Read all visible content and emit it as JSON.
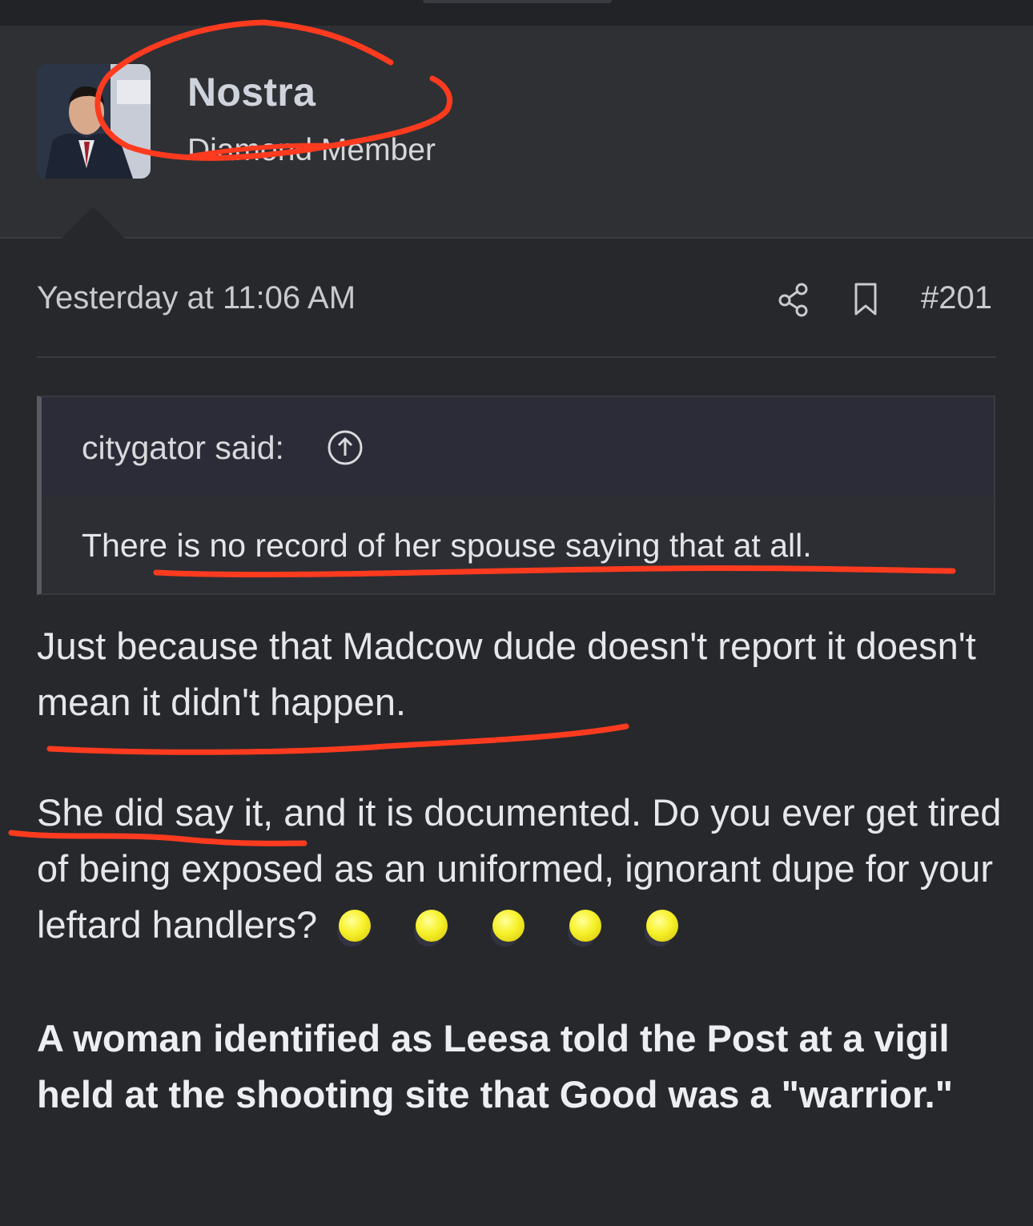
{
  "post": {
    "author": "Nostra",
    "author_title": "Diamond Member",
    "timestamp": "Yesterday at 11:06 AM",
    "post_number": "#201",
    "icons": [
      "share-icon",
      "bookmark-icon"
    ]
  },
  "quote": {
    "author_label": "citygator said:",
    "jump_icon": "arrow-up-circle-icon",
    "text": "There is no record of her spouse saying that at all."
  },
  "message": {
    "paragraph_1": "Just because that Madcow dude doesn't report it doesn't mean it didn't happen.",
    "paragraph_2": "She did say it, and it is documented. Do you ever get tired of being exposed as an uniformed, ignorant dupe for your leftard handlers?",
    "emoji_count": 5,
    "paragraph_3": "A woman identified as Leesa told the Post at a vigil held at the shooting site that Good was a \"warrior.\""
  },
  "colors": {
    "background": "#27282c",
    "userbar": "#2f3034",
    "annotation_red": "#ff3b1f",
    "text": "#e6e7ea"
  }
}
